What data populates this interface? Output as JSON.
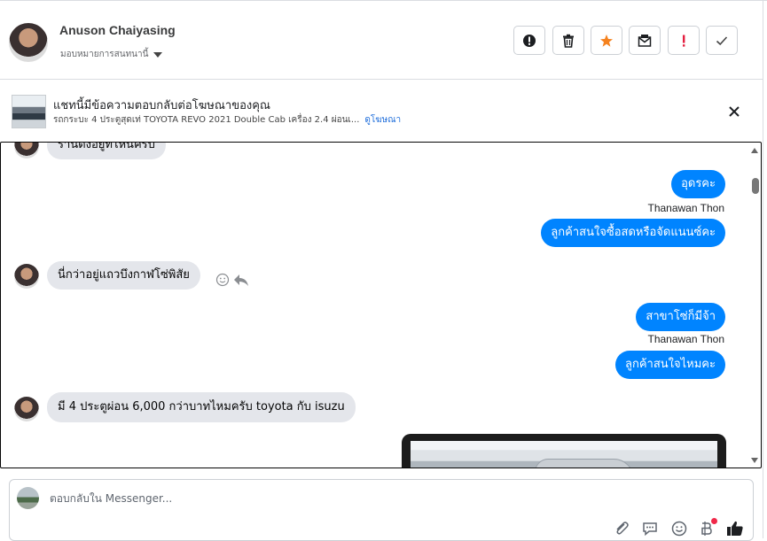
{
  "contact": {
    "name": "Anuson Chaiyasing",
    "assign_label": "มอบหมายการสนทนานี้"
  },
  "toolbar": {
    "buttons": [
      {
        "name": "mark-spam",
        "icon": "alert-circle-icon"
      },
      {
        "name": "delete",
        "icon": "trash-icon"
      },
      {
        "name": "star",
        "icon": "star-icon",
        "color": "#f5821f"
      },
      {
        "name": "mark-unread",
        "icon": "envelope-icon"
      },
      {
        "name": "flag",
        "icon": "exclamation-icon",
        "color": "#e41e3f"
      },
      {
        "name": "done",
        "icon": "check-icon"
      }
    ]
  },
  "ad": {
    "title": "แชทนี้มีข้อความตอบกลับต่อโฆษณาของคุณ",
    "subtitle": "รถกระบะ 4 ประตูสุดเท่ TOYOTA REVO 2021 Double Cab เครื่อง 2.4 ผ่อนเ...",
    "link_label": "ดูโฆษณา"
  },
  "messages": [
    {
      "id": "m0",
      "side": "in",
      "text": "ร้านตั้งอยู่ที่ไหนครับ"
    },
    {
      "id": "m1",
      "side": "out",
      "text": "อุดรคะ"
    },
    {
      "id": "m2",
      "side": "out",
      "text": "ลูกค้าสนใจซื้อสดหรือจัดแนนซ์คะ",
      "sender": "Thanawan Thon"
    },
    {
      "id": "m3",
      "side": "in",
      "text": "นี่กว่าอยู่แถวบึงกาฬโซ่พิสัย"
    },
    {
      "id": "m4",
      "side": "out",
      "text": "สาขาโซ่ก็มีจ้า"
    },
    {
      "id": "m5",
      "side": "out",
      "text": "ลูกค้าสนใจไหมคะ",
      "sender": "Thanawan Thon"
    },
    {
      "id": "m6",
      "side": "in",
      "text": "มี 4 ประตูผ่อน 6,000 กว่าบาทไหมครับ toyota กับ isuzu"
    }
  ],
  "composer": {
    "placeholder": "ตอบกลับใน Messenger...",
    "icons": [
      "paperclip-icon",
      "saved-reply-icon",
      "emoji-icon",
      "currency-icon",
      "like-icon"
    ]
  },
  "colors": {
    "outgoing_bubble": "#0084ff",
    "incoming_bubble": "#e4e6eb",
    "link": "#216fdb"
  }
}
